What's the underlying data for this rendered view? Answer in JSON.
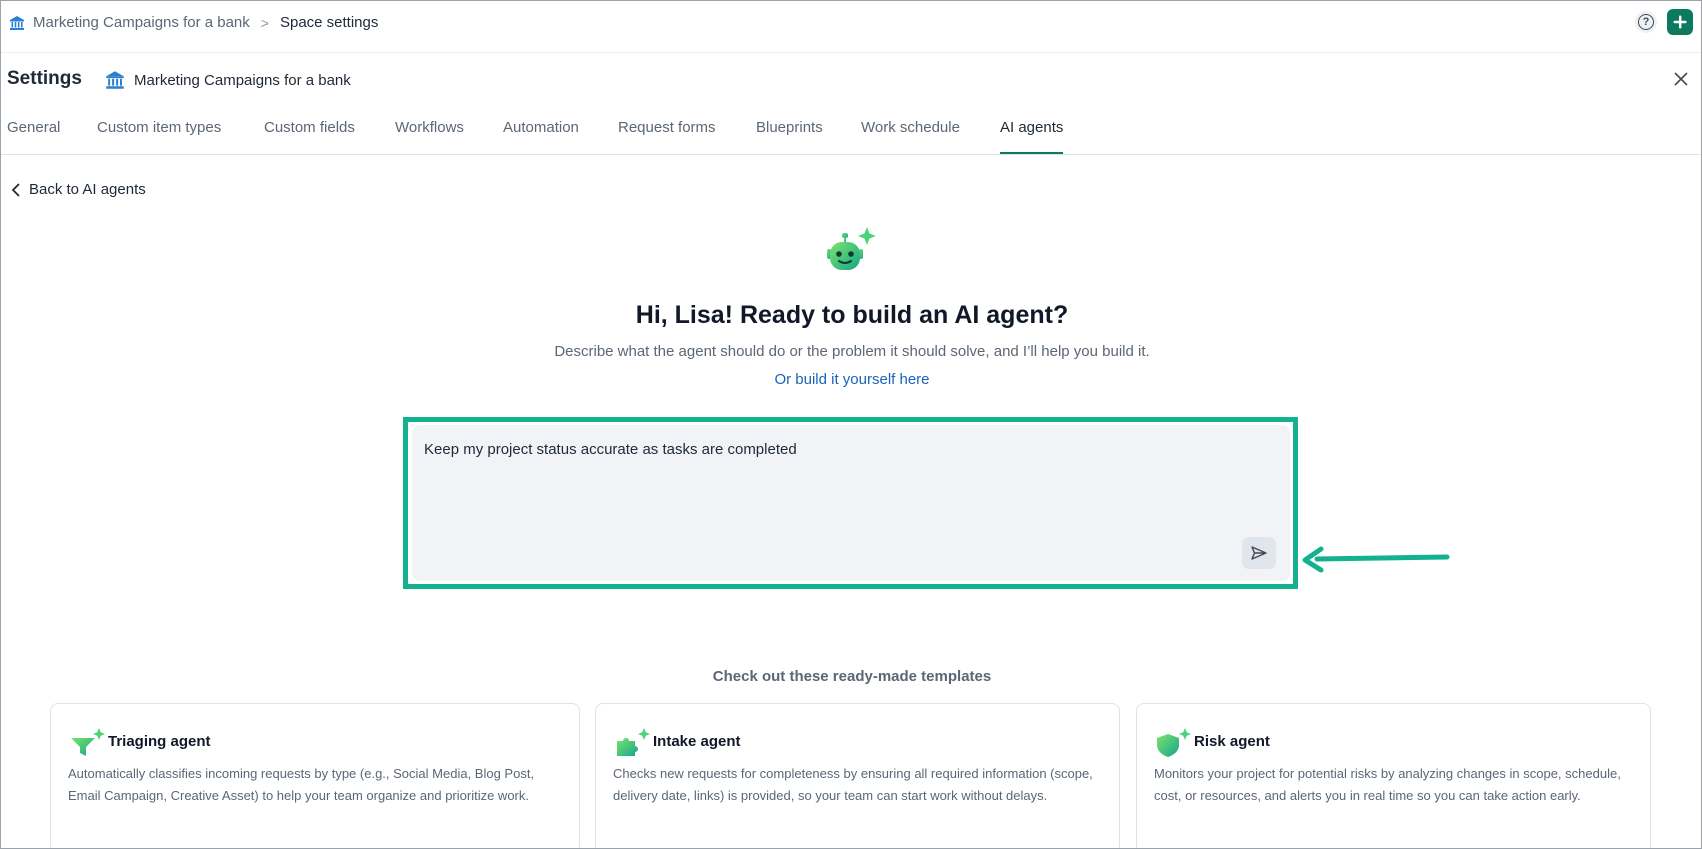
{
  "breadcrumb": {
    "space": "Marketing Campaigns for a bank",
    "separator": ">",
    "current": "Space settings"
  },
  "header": {
    "title": "Settings",
    "space_name": "Marketing Campaigns for a bank",
    "help_label": "?"
  },
  "tabs": [
    {
      "label": "General",
      "active": false
    },
    {
      "label": "Custom item types",
      "active": false
    },
    {
      "label": "Custom fields",
      "active": false
    },
    {
      "label": "Workflows",
      "active": false
    },
    {
      "label": "Automation",
      "active": false
    },
    {
      "label": "Request forms",
      "active": false
    },
    {
      "label": "Blueprints",
      "active": false
    },
    {
      "label": "Work schedule",
      "active": false
    },
    {
      "label": "AI agents",
      "active": true
    }
  ],
  "back_link": "Back to AI agents",
  "hero": {
    "title": "Hi, Lisa! Ready to build an AI agent?",
    "subtitle": "Describe what the agent should do or the problem it should solve, and I’ll help you build it.",
    "link": "Or build it yourself here"
  },
  "prompt": {
    "value": "Keep my project status accurate as tasks are completed"
  },
  "templates": {
    "heading": "Check out these ready-made templates",
    "cards": [
      {
        "icon": "funnel-sparkle-icon",
        "title": "Triaging agent",
        "description": "Automatically classifies incoming requests by type (e.g., Social Media, Blog Post, Email Campaign, Creative Asset) to help your team organize and prioritize work."
      },
      {
        "icon": "puzzle-sparkle-icon",
        "title": "Intake agent",
        "description": "Checks new requests for completeness by ensuring all required information (scope, delivery date, links) is provided, so your team can start work without delays."
      },
      {
        "icon": "shield-sparkle-icon",
        "title": "Risk agent",
        "description": "Monitors your project for potential risks by analyzing changes in scope, schedule, cost, or resources, and alerts you in real time so you can take action early."
      }
    ]
  },
  "colors": {
    "accent_green": "#0d7a5f",
    "highlight_outline": "#14b18f",
    "link_blue": "#1764b8",
    "icon_blue": "#2a7fd1"
  }
}
